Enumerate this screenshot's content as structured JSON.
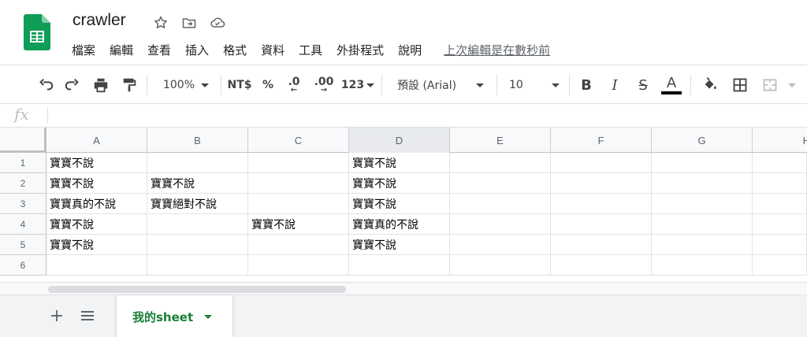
{
  "header": {
    "title": "crawler",
    "menu": [
      "檔案",
      "編輯",
      "查看",
      "插入",
      "格式",
      "資料",
      "工具",
      "外掛程式",
      "說明"
    ],
    "last_edit": "上次編輯是在數秒前"
  },
  "toolbar": {
    "zoom": "100%",
    "currency": "NT$",
    "percent": "%",
    "decrease_decimal": ".0",
    "increase_decimal": ".00",
    "more_formats": "123",
    "font": "預設 (Arial)",
    "font_size": "10",
    "bold": "B",
    "italic": "I",
    "strike": "S",
    "text_color": "A"
  },
  "formula_bar": {
    "fx": "fx",
    "value": ""
  },
  "sheet": {
    "columns": [
      "A",
      "B",
      "C",
      "D",
      "E",
      "F",
      "G",
      "H"
    ],
    "rows": [
      "1",
      "2",
      "3",
      "4",
      "5",
      "6"
    ],
    "cells": [
      [
        "寶寶不說",
        "",
        "",
        "寶寶不說",
        "",
        "",
        "",
        ""
      ],
      [
        "寶寶不說",
        "寶寶不說",
        "",
        "寶寶不說",
        "",
        "",
        "",
        ""
      ],
      [
        "寶寶真的不說",
        "寶寶絕對不說",
        "",
        "寶寶不說",
        "",
        "",
        "",
        ""
      ],
      [
        "寶寶不說",
        "",
        "寶寶不說",
        "寶寶真的不說",
        "",
        "",
        "",
        ""
      ],
      [
        "寶寶不說",
        "",
        "",
        "寶寶不說",
        "",
        "",
        "",
        ""
      ],
      [
        "",
        "",
        "",
        "",
        "",
        "",
        "",
        ""
      ]
    ]
  },
  "tabs": {
    "add_label": "+",
    "active_sheet": "我的sheet"
  },
  "colors": {
    "brand_green": "#188038",
    "logo_green": "#0f9d58"
  }
}
